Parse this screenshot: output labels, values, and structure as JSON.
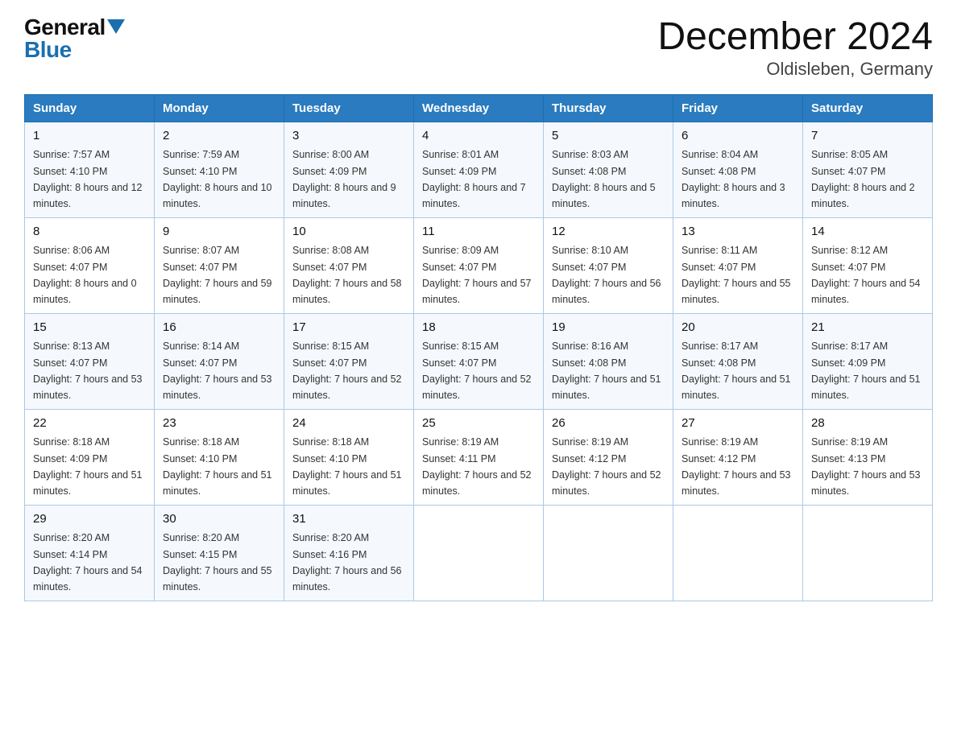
{
  "header": {
    "logo_general": "General",
    "logo_blue": "Blue",
    "title": "December 2024",
    "subtitle": "Oldisleben, Germany"
  },
  "days_of_week": [
    "Sunday",
    "Monday",
    "Tuesday",
    "Wednesday",
    "Thursday",
    "Friday",
    "Saturday"
  ],
  "weeks": [
    [
      {
        "day": 1,
        "sunrise": "7:57 AM",
        "sunset": "4:10 PM",
        "daylight": "8 hours and 12 minutes."
      },
      {
        "day": 2,
        "sunrise": "7:59 AM",
        "sunset": "4:10 PM",
        "daylight": "8 hours and 10 minutes."
      },
      {
        "day": 3,
        "sunrise": "8:00 AM",
        "sunset": "4:09 PM",
        "daylight": "8 hours and 9 minutes."
      },
      {
        "day": 4,
        "sunrise": "8:01 AM",
        "sunset": "4:09 PM",
        "daylight": "8 hours and 7 minutes."
      },
      {
        "day": 5,
        "sunrise": "8:03 AM",
        "sunset": "4:08 PM",
        "daylight": "8 hours and 5 minutes."
      },
      {
        "day": 6,
        "sunrise": "8:04 AM",
        "sunset": "4:08 PM",
        "daylight": "8 hours and 3 minutes."
      },
      {
        "day": 7,
        "sunrise": "8:05 AM",
        "sunset": "4:07 PM",
        "daylight": "8 hours and 2 minutes."
      }
    ],
    [
      {
        "day": 8,
        "sunrise": "8:06 AM",
        "sunset": "4:07 PM",
        "daylight": "8 hours and 0 minutes."
      },
      {
        "day": 9,
        "sunrise": "8:07 AM",
        "sunset": "4:07 PM",
        "daylight": "7 hours and 59 minutes."
      },
      {
        "day": 10,
        "sunrise": "8:08 AM",
        "sunset": "4:07 PM",
        "daylight": "7 hours and 58 minutes."
      },
      {
        "day": 11,
        "sunrise": "8:09 AM",
        "sunset": "4:07 PM",
        "daylight": "7 hours and 57 minutes."
      },
      {
        "day": 12,
        "sunrise": "8:10 AM",
        "sunset": "4:07 PM",
        "daylight": "7 hours and 56 minutes."
      },
      {
        "day": 13,
        "sunrise": "8:11 AM",
        "sunset": "4:07 PM",
        "daylight": "7 hours and 55 minutes."
      },
      {
        "day": 14,
        "sunrise": "8:12 AM",
        "sunset": "4:07 PM",
        "daylight": "7 hours and 54 minutes."
      }
    ],
    [
      {
        "day": 15,
        "sunrise": "8:13 AM",
        "sunset": "4:07 PM",
        "daylight": "7 hours and 53 minutes."
      },
      {
        "day": 16,
        "sunrise": "8:14 AM",
        "sunset": "4:07 PM",
        "daylight": "7 hours and 53 minutes."
      },
      {
        "day": 17,
        "sunrise": "8:15 AM",
        "sunset": "4:07 PM",
        "daylight": "7 hours and 52 minutes."
      },
      {
        "day": 18,
        "sunrise": "8:15 AM",
        "sunset": "4:07 PM",
        "daylight": "7 hours and 52 minutes."
      },
      {
        "day": 19,
        "sunrise": "8:16 AM",
        "sunset": "4:08 PM",
        "daylight": "7 hours and 51 minutes."
      },
      {
        "day": 20,
        "sunrise": "8:17 AM",
        "sunset": "4:08 PM",
        "daylight": "7 hours and 51 minutes."
      },
      {
        "day": 21,
        "sunrise": "8:17 AM",
        "sunset": "4:09 PM",
        "daylight": "7 hours and 51 minutes."
      }
    ],
    [
      {
        "day": 22,
        "sunrise": "8:18 AM",
        "sunset": "4:09 PM",
        "daylight": "7 hours and 51 minutes."
      },
      {
        "day": 23,
        "sunrise": "8:18 AM",
        "sunset": "4:10 PM",
        "daylight": "7 hours and 51 minutes."
      },
      {
        "day": 24,
        "sunrise": "8:18 AM",
        "sunset": "4:10 PM",
        "daylight": "7 hours and 51 minutes."
      },
      {
        "day": 25,
        "sunrise": "8:19 AM",
        "sunset": "4:11 PM",
        "daylight": "7 hours and 52 minutes."
      },
      {
        "day": 26,
        "sunrise": "8:19 AM",
        "sunset": "4:12 PM",
        "daylight": "7 hours and 52 minutes."
      },
      {
        "day": 27,
        "sunrise": "8:19 AM",
        "sunset": "4:12 PM",
        "daylight": "7 hours and 53 minutes."
      },
      {
        "day": 28,
        "sunrise": "8:19 AM",
        "sunset": "4:13 PM",
        "daylight": "7 hours and 53 minutes."
      }
    ],
    [
      {
        "day": 29,
        "sunrise": "8:20 AM",
        "sunset": "4:14 PM",
        "daylight": "7 hours and 54 minutes."
      },
      {
        "day": 30,
        "sunrise": "8:20 AM",
        "sunset": "4:15 PM",
        "daylight": "7 hours and 55 minutes."
      },
      {
        "day": 31,
        "sunrise": "8:20 AM",
        "sunset": "4:16 PM",
        "daylight": "7 hours and 56 minutes."
      },
      null,
      null,
      null,
      null
    ]
  ]
}
